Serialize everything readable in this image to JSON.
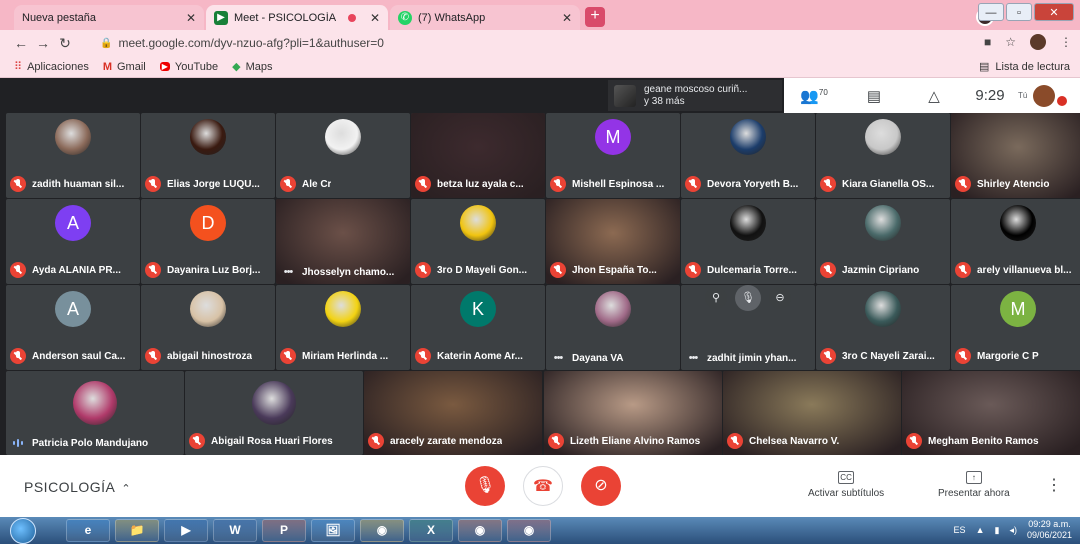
{
  "browser": {
    "tabs": [
      {
        "title": "Nueva pestaña",
        "active": false
      },
      {
        "title": "Meet - PSICOLOGÍA",
        "active": true
      },
      {
        "title": "(7) WhatsApp",
        "active": false
      }
    ],
    "url": "meet.google.com/dyv-nzuo-afg?pli=1&authuser=0",
    "bookmarks": [
      "Aplicaciones",
      "Gmail",
      "YouTube",
      "Maps"
    ],
    "reading_list": "Lista de lectura"
  },
  "meet": {
    "presenter_name": "geane moscoso curiñ...",
    "presenter_more": "y 38 más",
    "participant_count": "70",
    "time": "9:29",
    "self_label": "Tú",
    "meeting_name": "PSICOLOGÍA",
    "subtitles_label": "Activar subtítulos",
    "present_label": "Presentar ahora",
    "colors": {
      "accent_red": "#ea4335",
      "tile_bg": "#3c4043",
      "bg": "#202124"
    }
  },
  "participants": [
    {
      "name": "zadith huaman sil...",
      "type": "img",
      "color": "#8b6a5a",
      "state": "muted"
    },
    {
      "name": "Elias Jorge LUQU...",
      "type": "img",
      "color": "#3a1a10",
      "state": "muted"
    },
    {
      "name": "Ale Cr",
      "type": "img",
      "color": "#f2f2f2",
      "state": "muted"
    },
    {
      "name": "betza luz ayala c...",
      "type": "video",
      "color": "#3d2a2e",
      "state": "muted"
    },
    {
      "name": "Mishell Espinosa ...",
      "type": "letter",
      "letter": "M",
      "color": "#9334e6",
      "state": "muted"
    },
    {
      "name": "Devora Yoryeth B...",
      "type": "img",
      "color": "#1c3d6b",
      "state": "muted"
    },
    {
      "name": "Kiara Gianella OS...",
      "type": "img",
      "color": "#c8c8c8",
      "state": "muted"
    },
    {
      "name": "Shirley Atencio",
      "type": "video",
      "color": "#7a6a5c",
      "state": "muted"
    },
    {
      "name": "Ayda ALANIA PR...",
      "type": "letter",
      "letter": "A",
      "color": "#7e3ff2",
      "state": "muted"
    },
    {
      "name": "Dayanira Luz Borj...",
      "type": "letter",
      "letter": "D",
      "color": "#f4511e",
      "state": "muted"
    },
    {
      "name": "Jhosselyn chamo...",
      "type": "video",
      "color": "#6b5048",
      "state": "dots"
    },
    {
      "name": "3ro D Mayeli Gon...",
      "type": "img",
      "color": "#f1c40f",
      "state": "muted"
    },
    {
      "name": "Jhon España To...",
      "type": "video",
      "color": "#8c6a52",
      "state": "muted"
    },
    {
      "name": "Dulcemaria Torre...",
      "type": "img",
      "color": "#111111",
      "state": "muted"
    },
    {
      "name": "Jazmin Cipriano",
      "type": "img",
      "color": "#4a6a6a",
      "state": "muted"
    },
    {
      "name": "arely villanueva bl...",
      "type": "img",
      "color": "#000000",
      "state": "muted"
    },
    {
      "name": "Anderson saul Ca...",
      "type": "letter",
      "letter": "A",
      "color": "#78909c",
      "state": "muted"
    },
    {
      "name": "abigail hinostroza",
      "type": "img",
      "color": "#d8c2a6",
      "state": "muted"
    },
    {
      "name": "Miriam Herlinda ...",
      "type": "img",
      "color": "#f3d312",
      "state": "muted"
    },
    {
      "name": "Katerin Aome Ar...",
      "type": "letter",
      "letter": "K",
      "color": "#00796b",
      "state": "muted"
    },
    {
      "name": "Dayana VA",
      "type": "img",
      "color": "#a06a88",
      "state": "dots"
    },
    {
      "name": "zadhit jimin yhan...",
      "type": "hover",
      "color": "#6b6f8a",
      "state": "dots"
    },
    {
      "name": "3ro C Nayeli Zarai...",
      "type": "img",
      "color": "#3a5a5a",
      "state": "muted"
    },
    {
      "name": "Margorie C P",
      "type": "letter",
      "letter": "M",
      "color": "#7cb342",
      "state": "muted"
    },
    {
      "name": "Patricia Polo Mandujano",
      "type": "img",
      "color": "#b03a6a",
      "state": "speaking"
    },
    {
      "name": "Abigail Rosa Huari Flores",
      "type": "img",
      "color": "#4a3a5a",
      "state": "muted"
    },
    {
      "name": "aracely zarate mendoza",
      "type": "video",
      "color": "#7a5a40",
      "state": "muted"
    },
    {
      "name": "Lizeth Eliane Alvino Ramos",
      "type": "video",
      "color": "#b89a86",
      "state": "muted"
    },
    {
      "name": "Chelsea Navarro V.",
      "type": "video",
      "color": "#8a7a5a",
      "state": "muted"
    },
    {
      "name": "Megham Benito Ramos",
      "type": "video",
      "color": "#6a5a58",
      "state": "muted"
    }
  ],
  "taskbar": {
    "apps": [
      "e",
      "📁",
      "▶",
      "W",
      "P",
      "🖼",
      "◉",
      "X",
      "◉",
      "◉"
    ],
    "lang": "ES",
    "time": "09:29 a.m.",
    "date": "09/06/2021"
  }
}
